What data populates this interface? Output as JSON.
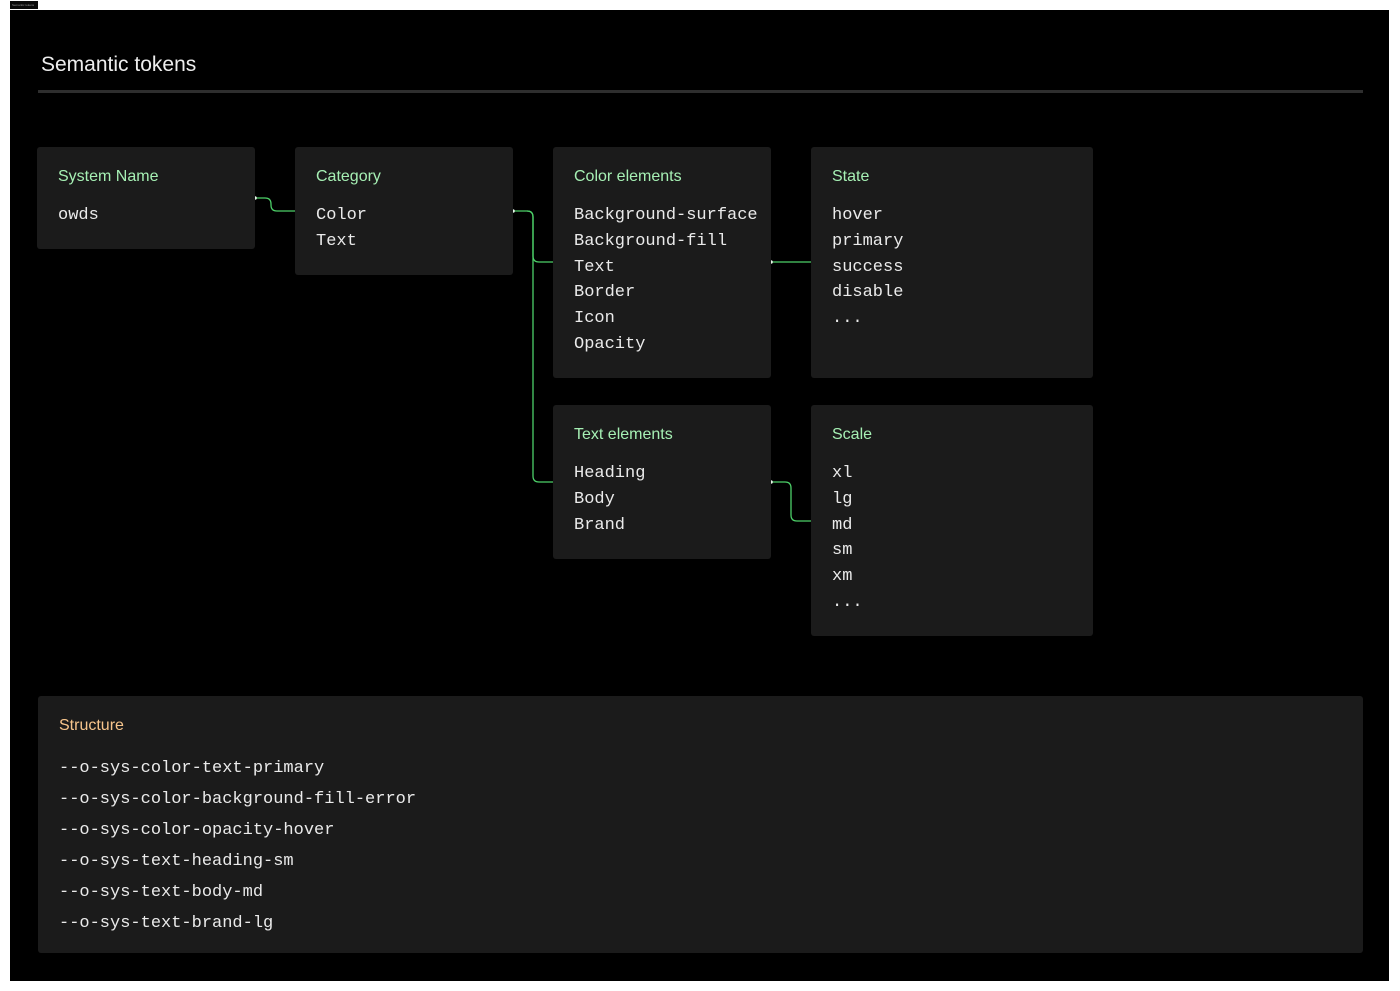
{
  "frame": {
    "tag_label": "Semantic tokens",
    "title": "Semantic tokens",
    "background": "#000000"
  },
  "cards": {
    "system_name": {
      "title": "System Name",
      "items": [
        "owds"
      ]
    },
    "category": {
      "title": "Category",
      "items": [
        "Color",
        "Text"
      ]
    },
    "color_elements": {
      "title": "Color elements",
      "items": [
        "Background-surface",
        "Background-fill",
        "Text",
        "Border",
        "Icon",
        "Opacity"
      ]
    },
    "state": {
      "title": "State",
      "items": [
        "hover",
        "primary",
        "success",
        "disable",
        "..."
      ]
    },
    "text_elements": {
      "title": "Text elements",
      "items": [
        "Heading",
        "Body",
        "Brand"
      ]
    },
    "scale": {
      "title": "Scale",
      "items": [
        "xl",
        "lg",
        "md",
        "sm",
        "xm",
        "..."
      ]
    }
  },
  "structure": {
    "title": "Structure",
    "items": [
      "--o-sys-color-text-primary",
      "--o-sys-color-background-fill-error",
      "--o-sys-color-opacity-hover",
      "--o-sys-text-heading-sm",
      "--o-sys-text-body-md",
      "--o-sys-text-brand-lg"
    ]
  },
  "colors": {
    "card_title": "#a6f0b4",
    "structure_title": "#f7c58c",
    "card_background": "#1b1b1b",
    "connector": "#4ccf68",
    "text": "#eaeaea"
  }
}
